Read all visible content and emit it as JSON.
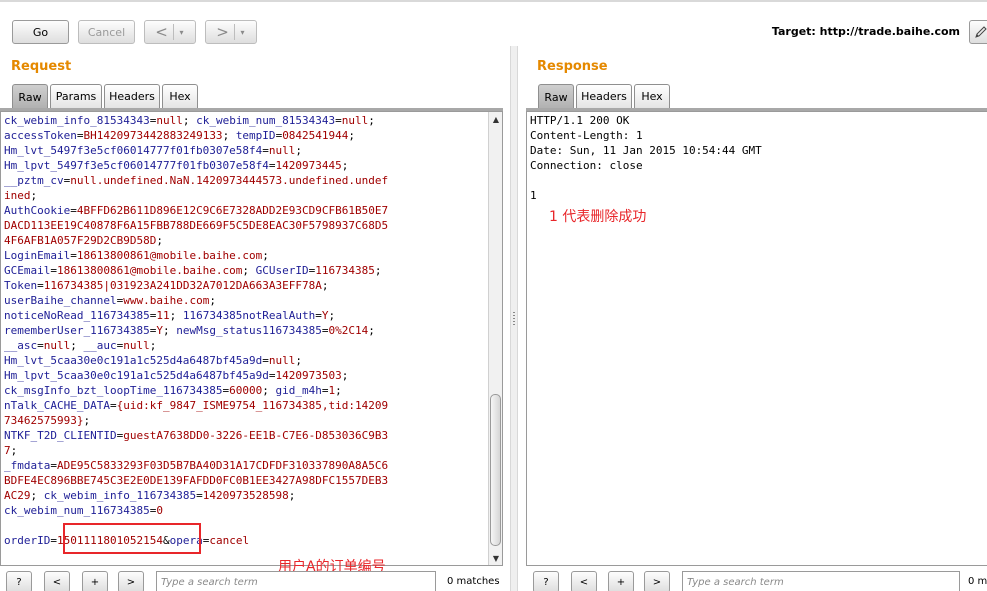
{
  "toolbar": {
    "go_label": "Go",
    "cancel_label": "Cancel",
    "back_arrow": "<",
    "forward_arrow": ">",
    "dropdown_glyph": "▾",
    "target_label": "Target: http://trade.baihe.com"
  },
  "request": {
    "title": "Request",
    "tabs": [
      "Raw",
      "Params",
      "Headers",
      "Hex"
    ],
    "active_tab": "Raw",
    "lines": [
      [
        {
          "t": "k",
          "s": "ck_webim_info_81534343"
        },
        {
          "t": "p",
          "s": "="
        },
        {
          "t": "v",
          "s": "null"
        },
        {
          "t": "p",
          "s": "; "
        },
        {
          "t": "k",
          "s": "ck_webim_num_81534343"
        },
        {
          "t": "p",
          "s": "="
        },
        {
          "t": "v",
          "s": "null"
        },
        {
          "t": "p",
          "s": ";"
        }
      ],
      [
        {
          "t": "k",
          "s": "accessToken"
        },
        {
          "t": "p",
          "s": "="
        },
        {
          "t": "v",
          "s": "BH1420973442883249133"
        },
        {
          "t": "p",
          "s": "; "
        },
        {
          "t": "k",
          "s": "tempID"
        },
        {
          "t": "p",
          "s": "="
        },
        {
          "t": "v",
          "s": "0842541944"
        },
        {
          "t": "p",
          "s": ";"
        }
      ],
      [
        {
          "t": "k",
          "s": "Hm_lvt_5497f3e5cf06014777f01fb0307e58f4"
        },
        {
          "t": "p",
          "s": "="
        },
        {
          "t": "v",
          "s": "null"
        },
        {
          "t": "p",
          "s": ";"
        }
      ],
      [
        {
          "t": "k",
          "s": "Hm_lpvt_5497f3e5cf06014777f01fb0307e58f4"
        },
        {
          "t": "p",
          "s": "="
        },
        {
          "t": "v",
          "s": "1420973445"
        },
        {
          "t": "p",
          "s": ";"
        }
      ],
      [
        {
          "t": "k",
          "s": "__pztm_cv"
        },
        {
          "t": "p",
          "s": "="
        },
        {
          "t": "v",
          "s": "null.undefined.NaN.1420973444573.undefined.undef"
        }
      ],
      [
        {
          "t": "v",
          "s": "ined"
        },
        {
          "t": "p",
          "s": ";"
        }
      ],
      [
        {
          "t": "k",
          "s": "AuthCookie"
        },
        {
          "t": "p",
          "s": "="
        },
        {
          "t": "v",
          "s": "4BFFD62B611D896E12C9C6E7328ADD2E93CD9CFB61B50E7"
        }
      ],
      [
        {
          "t": "v",
          "s": "DACD113EE19C40878F6A15FBB788DE669F5C5DE8EAC30F5798937C68D5"
        }
      ],
      [
        {
          "t": "v",
          "s": "4F6AFB1A057F29D2CB9D58D"
        },
        {
          "t": "p",
          "s": ";"
        }
      ],
      [
        {
          "t": "k",
          "s": "LoginEmail"
        },
        {
          "t": "p",
          "s": "="
        },
        {
          "t": "v",
          "s": "18613800861@mobile.baihe.com"
        },
        {
          "t": "p",
          "s": ";"
        }
      ],
      [
        {
          "t": "k",
          "s": "GCEmail"
        },
        {
          "t": "p",
          "s": "="
        },
        {
          "t": "v",
          "s": "18613800861@mobile.baihe.com"
        },
        {
          "t": "p",
          "s": "; "
        },
        {
          "t": "k",
          "s": "GCUserID"
        },
        {
          "t": "p",
          "s": "="
        },
        {
          "t": "v",
          "s": "116734385"
        },
        {
          "t": "p",
          "s": ";"
        }
      ],
      [
        {
          "t": "k",
          "s": "Token"
        },
        {
          "t": "p",
          "s": "="
        },
        {
          "t": "v",
          "s": "116734385|031923A241DD32A7012DA663A3EFF78A"
        },
        {
          "t": "p",
          "s": ";"
        }
      ],
      [
        {
          "t": "k",
          "s": "userBaihe_channel"
        },
        {
          "t": "p",
          "s": "="
        },
        {
          "t": "v",
          "s": "www.baihe.com"
        },
        {
          "t": "p",
          "s": ";"
        }
      ],
      [
        {
          "t": "k",
          "s": "noticeNoRead_116734385"
        },
        {
          "t": "p",
          "s": "="
        },
        {
          "t": "v",
          "s": "11"
        },
        {
          "t": "p",
          "s": "; "
        },
        {
          "t": "k",
          "s": "116734385notRealAuth"
        },
        {
          "t": "p",
          "s": "="
        },
        {
          "t": "v",
          "s": "Y"
        },
        {
          "t": "p",
          "s": ";"
        }
      ],
      [
        {
          "t": "k",
          "s": "rememberUser_116734385"
        },
        {
          "t": "p",
          "s": "="
        },
        {
          "t": "v",
          "s": "Y"
        },
        {
          "t": "p",
          "s": "; "
        },
        {
          "t": "k",
          "s": "newMsg_status116734385"
        },
        {
          "t": "p",
          "s": "="
        },
        {
          "t": "v",
          "s": "0%2C14"
        },
        {
          "t": "p",
          "s": ";"
        }
      ],
      [
        {
          "t": "k",
          "s": "__asc"
        },
        {
          "t": "p",
          "s": "="
        },
        {
          "t": "v",
          "s": "null"
        },
        {
          "t": "p",
          "s": "; "
        },
        {
          "t": "k",
          "s": "__auc"
        },
        {
          "t": "p",
          "s": "="
        },
        {
          "t": "v",
          "s": "null"
        },
        {
          "t": "p",
          "s": ";"
        }
      ],
      [
        {
          "t": "k",
          "s": "Hm_lvt_5caa30e0c191a1c525d4a6487bf45a9d"
        },
        {
          "t": "p",
          "s": "="
        },
        {
          "t": "v",
          "s": "null"
        },
        {
          "t": "p",
          "s": ";"
        }
      ],
      [
        {
          "t": "k",
          "s": "Hm_lpvt_5caa30e0c191a1c525d4a6487bf45a9d"
        },
        {
          "t": "p",
          "s": "="
        },
        {
          "t": "v",
          "s": "1420973503"
        },
        {
          "t": "p",
          "s": ";"
        }
      ],
      [
        {
          "t": "k",
          "s": "ck_msgInfo_bzt_loopTime_116734385"
        },
        {
          "t": "p",
          "s": "="
        },
        {
          "t": "v",
          "s": "60000"
        },
        {
          "t": "p",
          "s": "; "
        },
        {
          "t": "k",
          "s": "gid_m4h"
        },
        {
          "t": "p",
          "s": "="
        },
        {
          "t": "v",
          "s": "1"
        },
        {
          "t": "p",
          "s": ";"
        }
      ],
      [
        {
          "t": "k",
          "s": "nTalk_CACHE_DATA"
        },
        {
          "t": "p",
          "s": "="
        },
        {
          "t": "v",
          "s": "{uid:kf_9847_ISME9754_116734385,tid:14209"
        }
      ],
      [
        {
          "t": "v",
          "s": "73462575993}"
        },
        {
          "t": "p",
          "s": ";"
        }
      ],
      [
        {
          "t": "k",
          "s": "NTKF_T2D_CLIENTID"
        },
        {
          "t": "p",
          "s": "="
        },
        {
          "t": "v",
          "s": "guestA7638DD0-3226-EE1B-C7E6-D853036C9B3"
        }
      ],
      [
        {
          "t": "v",
          "s": "7"
        },
        {
          "t": "p",
          "s": ";"
        }
      ],
      [
        {
          "t": "k",
          "s": "_fmdata"
        },
        {
          "t": "p",
          "s": "="
        },
        {
          "t": "v",
          "s": "ADE95C5833293F03D5B7BA40D31A17CDFDF310337890A8A5C6"
        }
      ],
      [
        {
          "t": "v",
          "s": "BDFE4EC896BBE745C3E2E0DE139FAFDD0FC0B1EE3427A98DFC1557DEB3"
        }
      ],
      [
        {
          "t": "v",
          "s": "AC29"
        },
        {
          "t": "p",
          "s": "; "
        },
        {
          "t": "k",
          "s": "ck_webim_info_116734385"
        },
        {
          "t": "p",
          "s": "="
        },
        {
          "t": "v",
          "s": "1420973528598"
        },
        {
          "t": "p",
          "s": ";"
        }
      ],
      [
        {
          "t": "k",
          "s": "ck_webim_num_116734385"
        },
        {
          "t": "p",
          "s": "="
        },
        {
          "t": "v",
          "s": "0"
        }
      ],
      [],
      [
        {
          "t": "k",
          "s": "orderID"
        },
        {
          "t": "p",
          "s": "="
        },
        {
          "t": "v",
          "s": "1501111801052154"
        },
        {
          "t": "p",
          "s": "&"
        },
        {
          "t": "k",
          "s": "opera"
        },
        {
          "t": "p",
          "s": "="
        },
        {
          "t": "v",
          "s": "cancel"
        }
      ]
    ],
    "scroll_up": "▲",
    "scroll_down": "▼",
    "search_placeholder": "Type a search term",
    "matches": "0 matches"
  },
  "response": {
    "title": "Response",
    "tabs": [
      "Raw",
      "Headers",
      "Hex"
    ],
    "active_tab": "Raw",
    "lines": [
      "HTTP/1.1 200 OK",
      "Content-Length: 1",
      "Date: Sun, 11 Jan 2015 10:54:44 GMT",
      "Connection: close",
      "",
      "1"
    ],
    "search_placeholder": "Type a search term",
    "matches": "0 m"
  },
  "search_buttons": {
    "help": "?",
    "prev": "<",
    "next_plus": "+",
    "next": ">"
  },
  "annotations": {
    "order_note": "用户A的订单编号",
    "delete_note": "1 代表删除成功"
  },
  "colors": {
    "title_orange": "#e58900",
    "key_blue": "#1e1e96",
    "value_red": "#a00000",
    "annotation_red": "#e8262a"
  }
}
